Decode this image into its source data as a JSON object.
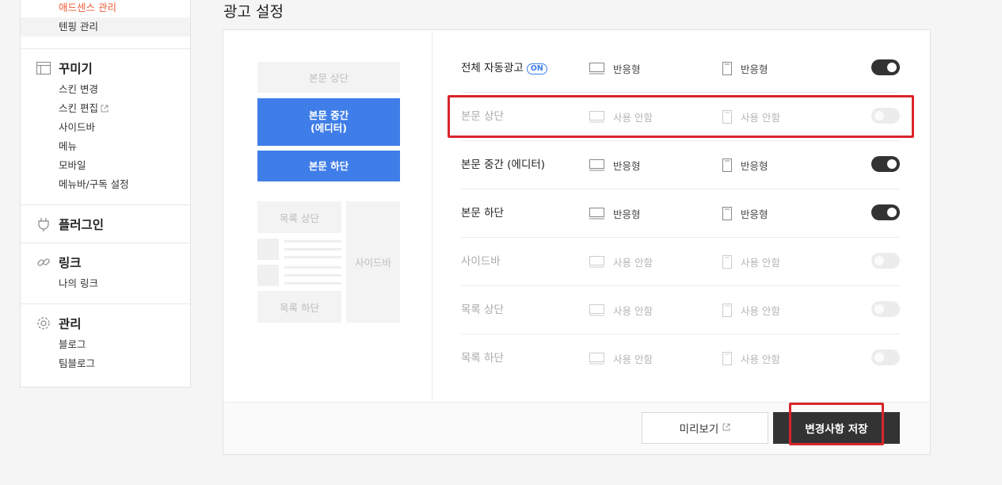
{
  "sidebar": {
    "top_items": [
      {
        "label": "애드센스 관리"
      },
      {
        "label": "텐핑 관리"
      }
    ],
    "sections": [
      {
        "title": "꾸미기",
        "icon": "layout-icon",
        "items": [
          "스킨 변경",
          "스킨 편집",
          "사이드바",
          "메뉴",
          "모바일",
          "메뉴바/구독 설정"
        ]
      },
      {
        "title": "플러그인",
        "icon": "plug-icon",
        "items": []
      },
      {
        "title": "링크",
        "icon": "link-icon",
        "items": [
          "나의 링크"
        ]
      },
      {
        "title": "관리",
        "icon": "gear-icon",
        "items": [
          "블로그",
          "팀블로그"
        ]
      }
    ]
  },
  "page": {
    "title": "광고 설정"
  },
  "preview": {
    "content_top": "본문 상단",
    "content_mid": "본문 중간\n(에디터)",
    "content_bottom": "본문 하단",
    "list_top": "목록 상단",
    "list_bottom": "목록 하단",
    "sidebar": "사이드바"
  },
  "rows": [
    {
      "name": "전체 자동광고",
      "badge": "ON",
      "pc": "반응형",
      "mobile": "반응형",
      "enabled": true
    },
    {
      "name": "본문 상단",
      "pc": "사용 안함",
      "mobile": "사용 안함",
      "enabled": false
    },
    {
      "name": "본문 중간 (에디터)",
      "pc": "반응형",
      "mobile": "반응형",
      "enabled": true
    },
    {
      "name": "본문 하단",
      "pc": "반응형",
      "mobile": "반응형",
      "enabled": true
    },
    {
      "name": "사이드바",
      "pc": "사용 안함",
      "mobile": "사용 안함",
      "enabled": false
    },
    {
      "name": "목록 상단",
      "pc": "사용 안함",
      "mobile": "사용 안함",
      "enabled": false
    },
    {
      "name": "목록 하단",
      "pc": "사용 안함",
      "mobile": "사용 안함",
      "enabled": false
    }
  ],
  "footer": {
    "preview_label": "미리보기",
    "save_label": "변경사항 저장"
  },
  "colors": {
    "accent": "#3f7ee8",
    "active_link": "#ee5b36",
    "highlight": "#d9252c",
    "dark": "#333333"
  }
}
